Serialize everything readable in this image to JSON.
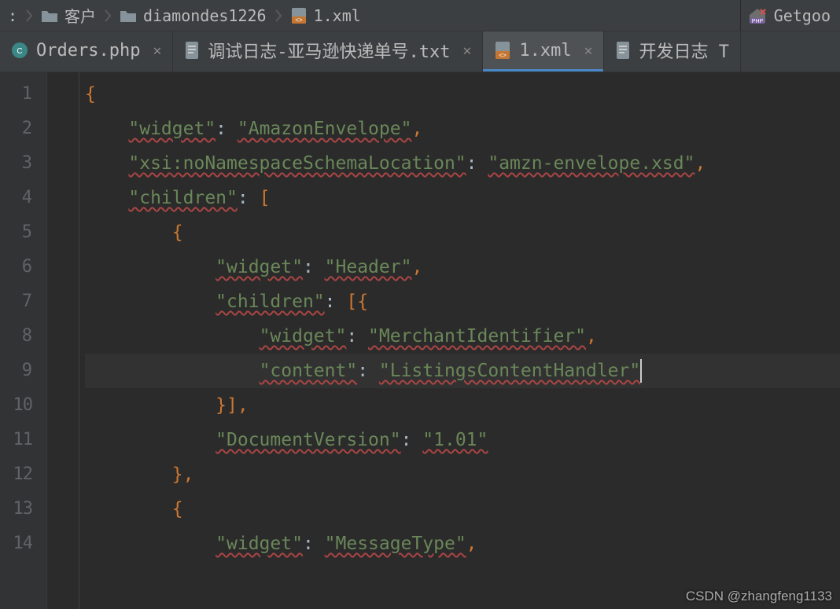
{
  "breadcrumb": {
    "prefix": ":",
    "items": [
      {
        "label": "客户",
        "icon": "folder"
      },
      {
        "label": "diamondes1226",
        "icon": "folder"
      },
      {
        "label": "1.xml",
        "icon": "xml"
      }
    ]
  },
  "toolbar_right": {
    "label": "Getgoo"
  },
  "tabs": [
    {
      "label": "Orders.php",
      "icon": "php",
      "closable": true,
      "active": false
    },
    {
      "label": "调试日志-亚马逊快递单号.txt",
      "icon": "txt",
      "closable": true,
      "active": false
    },
    {
      "label": "1.xml",
      "icon": "xml",
      "closable": true,
      "active": true
    },
    {
      "label": "开发日志 T",
      "icon": "txt",
      "closable": false,
      "active": false
    }
  ],
  "editor": {
    "current_line": 9,
    "lines": [
      {
        "n": 1,
        "indent": 0,
        "segments": [
          {
            "t": "{",
            "cls": "punc"
          }
        ]
      },
      {
        "n": 2,
        "indent": 1,
        "segments": [
          {
            "t": "\"widget\"",
            "cls": "str wavy"
          },
          {
            "t": ": ",
            "cls": ""
          },
          {
            "t": "\"AmazonEnvelope\"",
            "cls": "str wavy"
          },
          {
            "t": ",",
            "cls": "punc"
          }
        ]
      },
      {
        "n": 3,
        "indent": 1,
        "segments": [
          {
            "t": "\"xsi:noNamespaceSchemaLocation\"",
            "cls": "str wavy"
          },
          {
            "t": ": ",
            "cls": ""
          },
          {
            "t": "\"amzn-envelope.xsd\"",
            "cls": "str wavy"
          },
          {
            "t": ",",
            "cls": "punc"
          }
        ]
      },
      {
        "n": 4,
        "indent": 1,
        "segments": [
          {
            "t": "\"children\"",
            "cls": "str wavy"
          },
          {
            "t": ": ",
            "cls": ""
          },
          {
            "t": "[",
            "cls": "punc"
          }
        ]
      },
      {
        "n": 5,
        "indent": 2,
        "segments": [
          {
            "t": "{",
            "cls": "punc"
          }
        ]
      },
      {
        "n": 6,
        "indent": 3,
        "segments": [
          {
            "t": "\"widget\"",
            "cls": "str wavy"
          },
          {
            "t": ": ",
            "cls": ""
          },
          {
            "t": "\"Header\"",
            "cls": "str wavy"
          },
          {
            "t": ",",
            "cls": "punc"
          }
        ]
      },
      {
        "n": 7,
        "indent": 3,
        "segments": [
          {
            "t": "\"children\"",
            "cls": "str wavy"
          },
          {
            "t": ": ",
            "cls": ""
          },
          {
            "t": "[{",
            "cls": "punc"
          }
        ]
      },
      {
        "n": 8,
        "indent": 4,
        "segments": [
          {
            "t": "\"widget\"",
            "cls": "str wavy"
          },
          {
            "t": ": ",
            "cls": ""
          },
          {
            "t": "\"MerchantIdentifier\"",
            "cls": "str wavy"
          },
          {
            "t": ",",
            "cls": "punc"
          }
        ]
      },
      {
        "n": 9,
        "indent": 4,
        "segments": [
          {
            "t": "\"content\"",
            "cls": "str wavy"
          },
          {
            "t": ": ",
            "cls": ""
          },
          {
            "t": "\"ListingsContentHandler\"",
            "cls": "str wavy"
          }
        ],
        "caret": true
      },
      {
        "n": 10,
        "indent": 3,
        "segments": [
          {
            "t": "}],",
            "cls": "punc"
          }
        ]
      },
      {
        "n": 11,
        "indent": 3,
        "segments": [
          {
            "t": "\"DocumentVersion\"",
            "cls": "str wavy"
          },
          {
            "t": ": ",
            "cls": ""
          },
          {
            "t": "\"1.01\"",
            "cls": "str wavy"
          }
        ]
      },
      {
        "n": 12,
        "indent": 2,
        "segments": [
          {
            "t": "},",
            "cls": "punc"
          }
        ]
      },
      {
        "n": 13,
        "indent": 2,
        "segments": [
          {
            "t": "{",
            "cls": "punc"
          }
        ]
      },
      {
        "n": 14,
        "indent": 3,
        "segments": [
          {
            "t": "\"widget\"",
            "cls": "str wavy"
          },
          {
            "t": ": ",
            "cls": ""
          },
          {
            "t": "\"MessageType\"",
            "cls": "str wavy"
          },
          {
            "t": ",",
            "cls": "punc"
          }
        ]
      }
    ]
  },
  "watermark": "CSDN @zhangfeng1133"
}
